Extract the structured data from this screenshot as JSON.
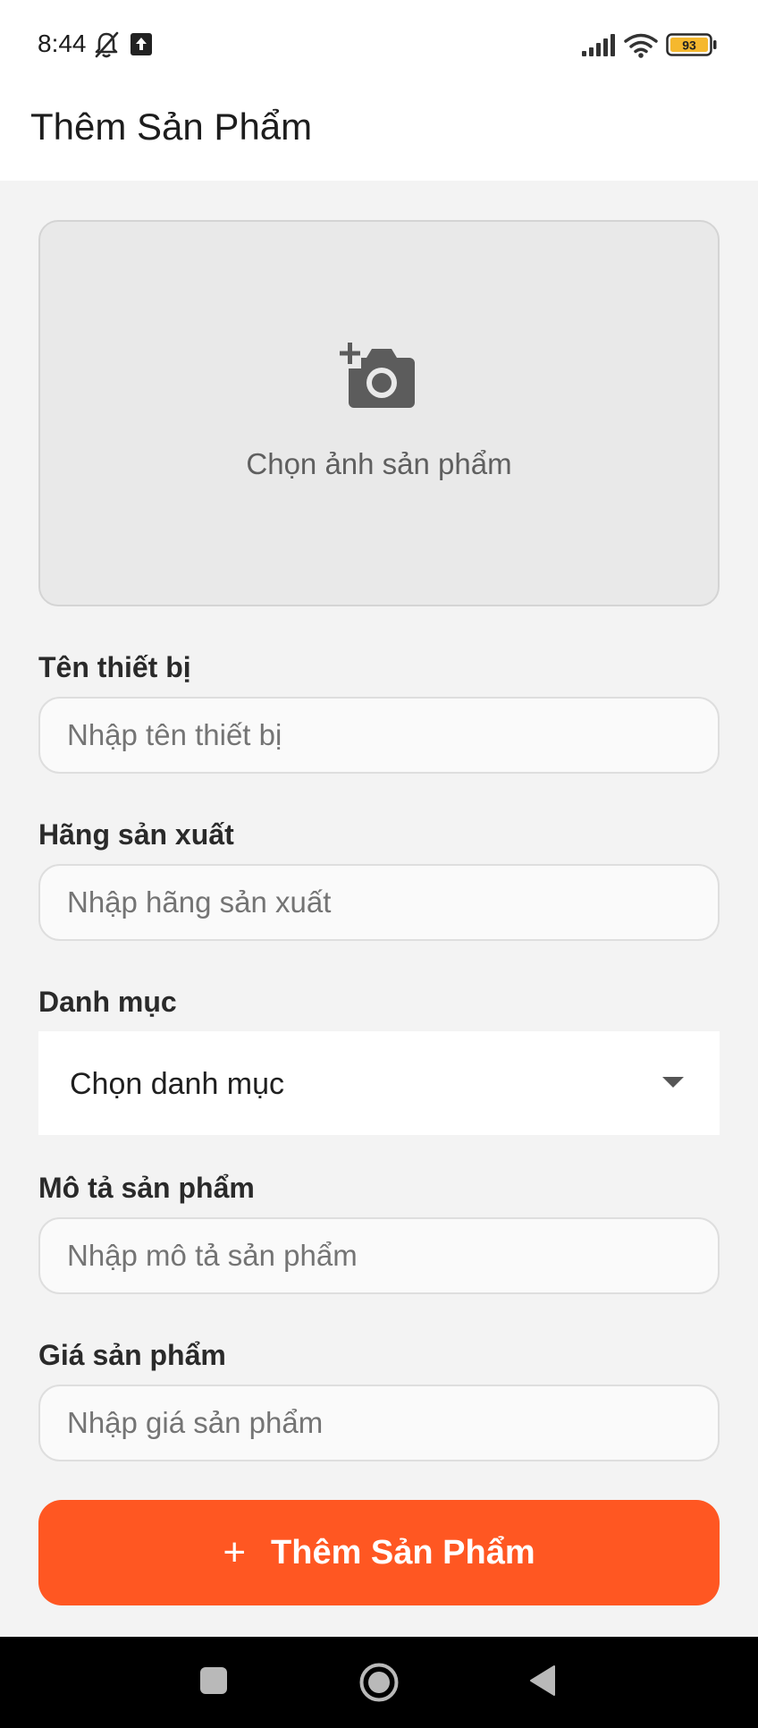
{
  "status_bar": {
    "time": "8:44",
    "battery_level": "93",
    "icons": [
      "bell-off-icon",
      "upload-icon",
      "signal-icon",
      "wifi-icon",
      "battery-icon"
    ],
    "battery_color": "#f5b82e"
  },
  "app_bar": {
    "title": "Thêm Sản Phẩm"
  },
  "image_picker": {
    "icon": "add-photo-icon",
    "label": "Chọn ảnh sản phẩm"
  },
  "form": {
    "device_name": {
      "label": "Tên thiết bị",
      "placeholder": "Nhập tên thiết bị",
      "value": ""
    },
    "manufacturer": {
      "label": "Hãng sản xuất",
      "placeholder": "Nhập hãng sản xuất",
      "value": ""
    },
    "category": {
      "label": "Danh mục",
      "selected": "Chọn danh mục",
      "icon": "dropdown-caret-icon"
    },
    "description": {
      "label": "Mô tả sản phẩm",
      "placeholder": "Nhập mô tả sản phẩm",
      "value": ""
    },
    "price": {
      "label": "Giá sản phẩm",
      "placeholder": "Nhập giá sản phẩm",
      "value": ""
    }
  },
  "submit_button": {
    "icon": "plus-icon",
    "icon_glyph": "+",
    "label": "Thêm Sản Phẩm",
    "color": "#ff5722"
  },
  "nav_bar": {
    "buttons": [
      "recent-apps-icon",
      "home-icon",
      "back-icon"
    ]
  }
}
